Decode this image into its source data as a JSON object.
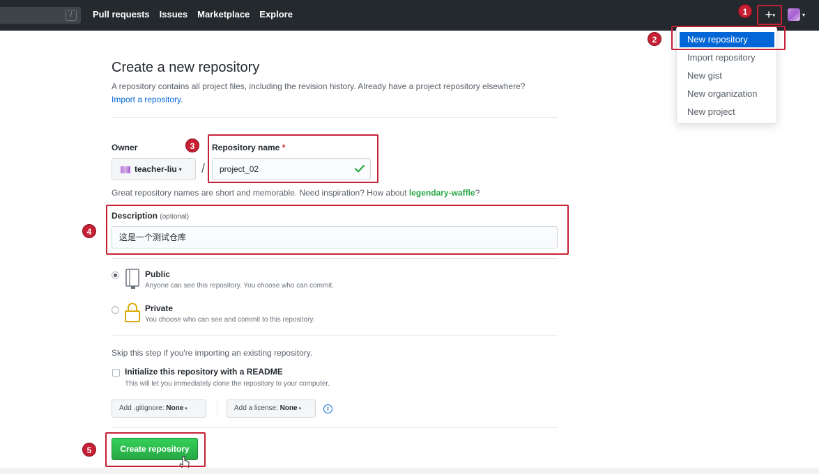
{
  "header": {
    "search_shortcut": "/",
    "nav": [
      "Pull requests",
      "Issues",
      "Marketplace",
      "Explore"
    ],
    "plus_label": "+",
    "caret": "▾"
  },
  "dropdown": {
    "items": [
      "New repository",
      "Import repository",
      "New gist",
      "New organization",
      "New project"
    ]
  },
  "annotations": [
    "1",
    "2",
    "3",
    "4",
    "5"
  ],
  "page": {
    "title": "Create a new repository",
    "subtitle": "A repository contains all project files, including the revision history. Already have a project repository elsewhere?",
    "import_link": "Import a repository."
  },
  "form": {
    "owner_label": "Owner",
    "owner_value": "teacher-liu",
    "slash": "/",
    "repo_name_label": "Repository name",
    "required_mark": "*",
    "repo_name_value": "project_02",
    "hint_prefix": "Great repository names are short and memorable. Need inspiration? How about ",
    "hint_suggestion": "legendary-waffle",
    "hint_suffix": "?",
    "description_label": "Description",
    "description_optional": "(optional)",
    "description_value": "这是一个测试仓库"
  },
  "visibility": {
    "public_title": "Public",
    "public_desc": "Anyone can see this repository. You choose who can commit.",
    "private_title": "Private",
    "private_desc": "You choose who can see and commit to this repository."
  },
  "init": {
    "skip_text": "Skip this step if you're importing an existing repository.",
    "readme_label": "Initialize this repository with a README",
    "readme_desc": "This will let you immediately clone the repository to your computer.",
    "gitignore_prefix": "Add .gitignore:",
    "gitignore_value": "None",
    "license_prefix": "Add a license:",
    "license_value": "None",
    "info_glyph": "i"
  },
  "submit": {
    "create_label": "Create repository"
  },
  "colors": {
    "header_bg": "#24292e",
    "annotation": "#c62034",
    "primary_green": "#28a745",
    "link_blue": "#0366d6"
  }
}
